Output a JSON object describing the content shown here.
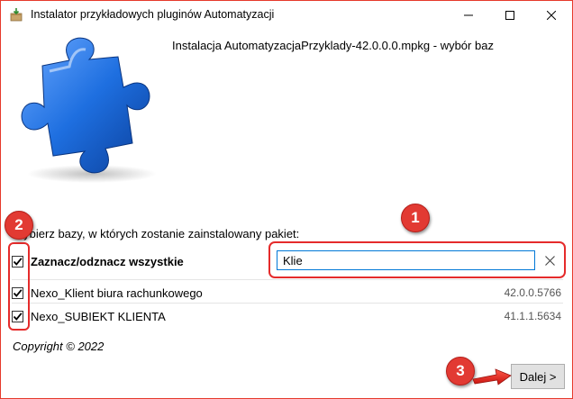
{
  "window": {
    "title": "Instalator przykładowych pluginów Automatyzacji",
    "icons": {
      "app": "installer-icon",
      "minimize": "minimize-icon",
      "maximize": "maximize-icon",
      "close": "close-icon"
    }
  },
  "main": {
    "heading": "Instalacja AutomatyzacjaPrzyklady-42.0.0.0.mpkg - wybór baz",
    "prompt": "Wybierz bazy, w których zostanie zainstalowany pakiet:",
    "select_all": {
      "label": "Zaznacz/odznacz wszystkie",
      "checked": true
    },
    "search": {
      "value": "Klie"
    },
    "databases": [
      {
        "name": "Nexo_Klient biura rachunkowego",
        "version": "42.0.0.5766",
        "checked": true
      },
      {
        "name": "Nexo_SUBIEKT KLIENTA",
        "version": "41.1.1.5634",
        "checked": true
      }
    ],
    "copyright": "Copyright © 2022"
  },
  "footer": {
    "next_label": "Dalej >"
  },
  "annotations": {
    "badge_1": "1",
    "badge_2": "2",
    "badge_3": "3"
  },
  "colors": {
    "accent_blue": "#0078d7",
    "highlight_red": "#e52b2b",
    "puzzle_blue": "#1e6fe0"
  }
}
